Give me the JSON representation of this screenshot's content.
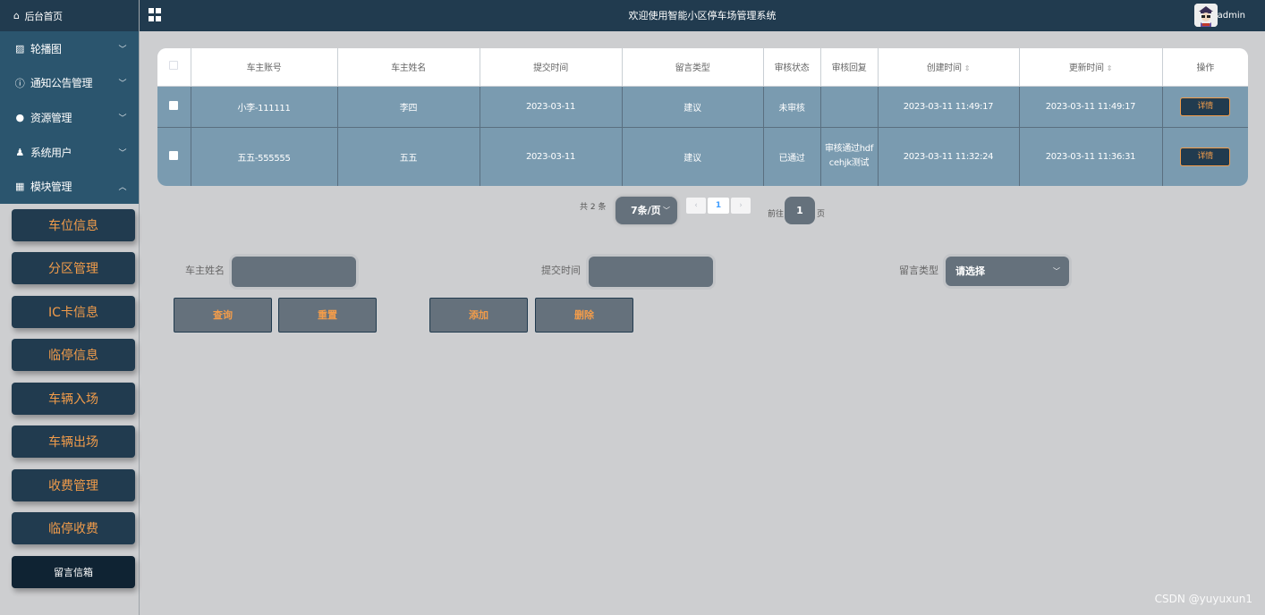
{
  "sidebar": {
    "home": "后台首页",
    "menu": [
      {
        "label": "轮播图",
        "icon": "image-icon"
      },
      {
        "label": "通知公告管理",
        "icon": "info-icon"
      },
      {
        "label": "资源管理",
        "icon": "pin-icon"
      },
      {
        "label": "系统用户",
        "icon": "user-icon"
      },
      {
        "label": "模块管理",
        "icon": "grid-icon"
      }
    ],
    "sub": [
      "车位信息",
      "分区管理",
      "IC卡信息",
      "临停信息",
      "车辆入场",
      "车辆出场",
      "收费管理",
      "临停收费",
      "留言信箱"
    ]
  },
  "topbar": {
    "title": "欢迎使用智能小区停车场管理系统",
    "user": "admin"
  },
  "table": {
    "headers": [
      "车主账号",
      "车主姓名",
      "提交时间",
      "留言类型",
      "审核状态",
      "审核回复",
      "创建时间",
      "更新时间",
      "操作"
    ],
    "rows": [
      {
        "account": "小李-111111",
        "name": "李四",
        "submit": "2023-03-11",
        "type": "建议",
        "status": "未审核",
        "reply": "",
        "created": "2023-03-11 11:49:17",
        "updated": "2023-03-11 11:49:17",
        "action": "详情"
      },
      {
        "account": "五五-555555",
        "name": "五五",
        "submit": "2023-03-11",
        "type": "建议",
        "status": "已通过",
        "reply": "审核通过hdfcehjk测试",
        "created": "2023-03-11 11:32:24",
        "updated": "2023-03-11 11:36:31",
        "action": "详情"
      }
    ]
  },
  "pager": {
    "total": "共 2 条",
    "size": "7条/页",
    "prev": "‹",
    "current": "1",
    "next": "›",
    "goto": "前往",
    "goto_value": "1",
    "page": "页"
  },
  "search": {
    "name_label": "车主姓名",
    "date_label": "提交时间",
    "type_label": "留言类型",
    "type_placeholder": "请选择"
  },
  "buttons": {
    "query": "查询",
    "reset": "重置",
    "add": "添加",
    "delete": "删除"
  },
  "watermark": "CSDN @yuyuxun1",
  "colors": {
    "sidebar_dark": "#213b4f",
    "sidebar_menu": "#2b556e",
    "accent_orange": "#f29c4a",
    "row_blue": "#7a9bb0",
    "input_gray": "#65717c"
  }
}
